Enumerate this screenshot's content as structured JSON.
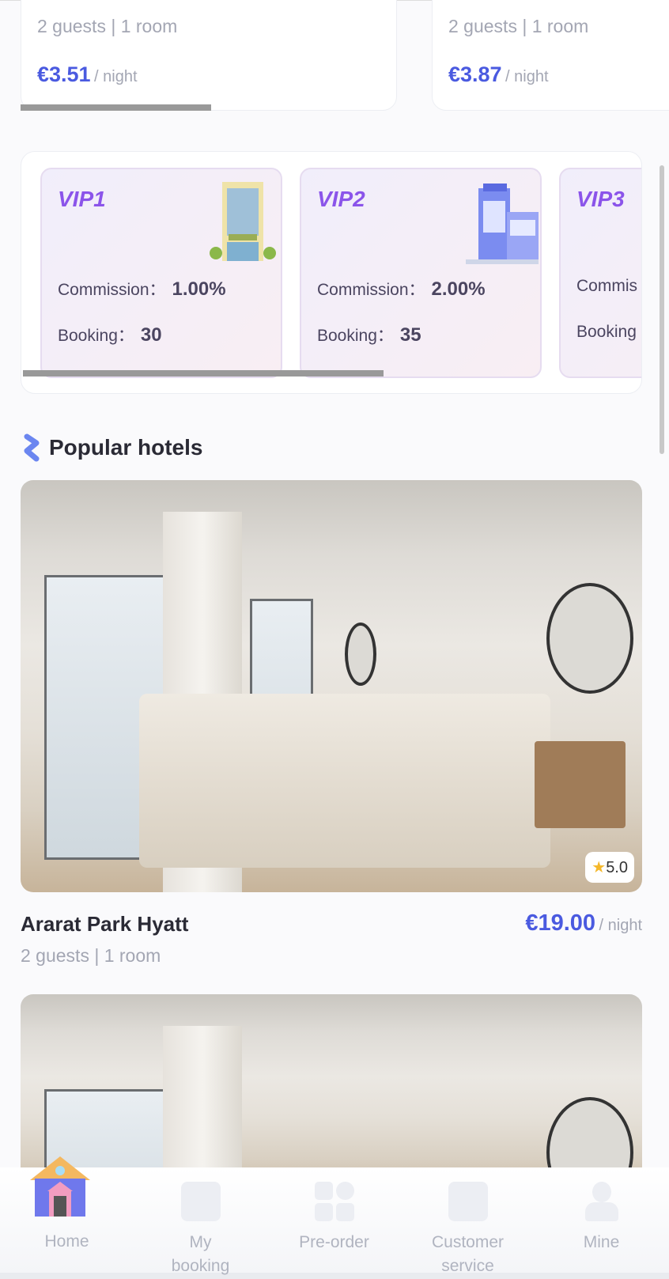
{
  "top_cards": [
    {
      "guests": "2 guests | 1 room",
      "price": "€3.51",
      "unit": "/ night"
    },
    {
      "guests": "2 guests | 1 room",
      "price": "€3.87",
      "unit": "/ night"
    }
  ],
  "vip_levels": [
    {
      "level": "VIP1",
      "commission_label": "Commission：",
      "commission": "1.00%",
      "booking_label": "Booking：",
      "booking": "30"
    },
    {
      "level": "VIP2",
      "commission_label": "Commission：",
      "commission": "2.00%",
      "booking_label": "Booking：",
      "booking": "35"
    },
    {
      "level": "VIP3",
      "commission_label": "Commis",
      "booking_label": "Booking"
    }
  ],
  "section": {
    "title": "Popular hotels"
  },
  "hotels": [
    {
      "name": "Ararat Park Hyatt",
      "guests": "2 guests | 1 room",
      "price": "€19.00",
      "unit": "/ night",
      "rating": "5.0"
    }
  ],
  "tabs": [
    {
      "label": "Home",
      "icon": "home-icon",
      "active": true
    },
    {
      "label": "My booking",
      "icon": "booking-icon"
    },
    {
      "label": "Pre-order",
      "icon": "grid-icon"
    },
    {
      "label": "Customer service",
      "icon": "chat-icon"
    },
    {
      "label": "Mine",
      "icon": "user-icon"
    }
  ],
  "colors": {
    "accent": "#4a5ae0",
    "vip": "#8b54ea"
  }
}
